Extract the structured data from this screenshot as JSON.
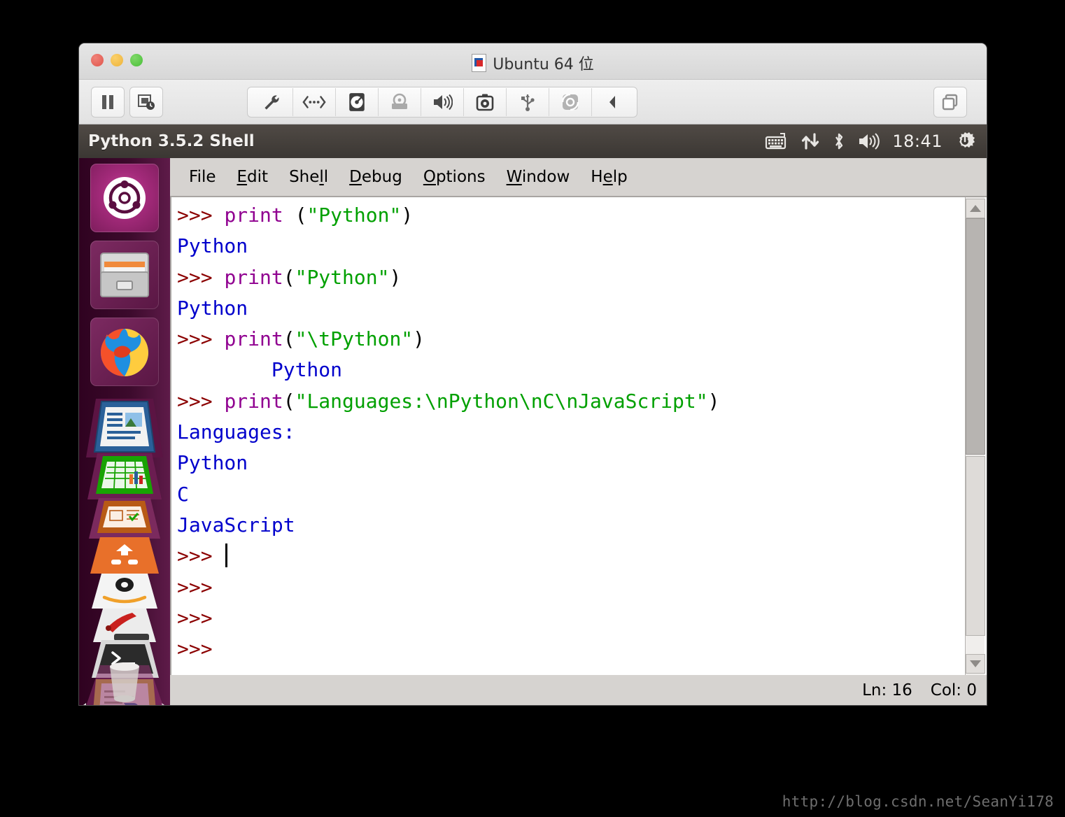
{
  "vm": {
    "title": "Ubuntu 64 位",
    "title_icon": "vm-document-icon",
    "traffic_lights": [
      {
        "name": "close-button",
        "color": "#e0564c"
      },
      {
        "name": "minimize-button",
        "color": "#edb33b"
      },
      {
        "name": "maximize-button",
        "color": "#49bf38"
      }
    ],
    "toolbar": {
      "pause_label": "Pause",
      "snapshot_label": "Snapshot",
      "unity_label": "Unity View",
      "devices": [
        {
          "name": "settings-wrench-icon",
          "label": "Settings",
          "enabled": true
        },
        {
          "name": "network-icon",
          "label": "Network Adapter",
          "enabled": true
        },
        {
          "name": "hard-disk-icon",
          "label": "Hard Disk",
          "enabled": true
        },
        {
          "name": "cd-dvd-icon",
          "label": "CD/DVD",
          "enabled": false
        },
        {
          "name": "sound-icon",
          "label": "Sound Card",
          "enabled": true
        },
        {
          "name": "camera-icon",
          "label": "Camera",
          "enabled": true
        },
        {
          "name": "usb-icon",
          "label": "USB Controller",
          "enabled": true
        },
        {
          "name": "shared-folders-icon",
          "label": "Shared Folders",
          "enabled": false
        },
        {
          "name": "collapse-arrow-icon",
          "label": "Collapse",
          "enabled": true
        }
      ]
    }
  },
  "ubuntu": {
    "panel": {
      "window_title": "Python 3.5.2 Shell",
      "clock": "18:41",
      "indicators": [
        {
          "name": "keyboard-indicator-icon",
          "label": "Keyboard layout"
        },
        {
          "name": "network-transfer-icon",
          "label": "Network"
        },
        {
          "name": "bluetooth-icon",
          "label": "Bluetooth"
        },
        {
          "name": "volume-icon",
          "label": "Sound"
        },
        {
          "name": "session-gear-icon",
          "label": "System menu"
        }
      ]
    },
    "launcher": {
      "items": [
        {
          "name": "launcher-item-dash",
          "label": "Ubuntu Dash"
        },
        {
          "name": "launcher-item-files",
          "label": "Files"
        },
        {
          "name": "launcher-item-firefox",
          "label": "Firefox Web Browser"
        },
        {
          "name": "launcher-item-writer",
          "label": "LibreOffice Writer"
        },
        {
          "name": "launcher-item-calc",
          "label": "LibreOffice Calc"
        },
        {
          "name": "launcher-item-impress",
          "label": "LibreOffice Impress"
        },
        {
          "name": "launcher-item-software",
          "label": "Ubuntu Software"
        },
        {
          "name": "launcher-item-amazon",
          "label": "Amazon"
        },
        {
          "name": "launcher-item-settings",
          "label": "System Settings"
        },
        {
          "name": "launcher-item-terminal",
          "label": "Terminal"
        },
        {
          "name": "launcher-item-idle",
          "label": "IDLE (Python 3.5)"
        },
        {
          "name": "launcher-item-trash",
          "label": "Trash"
        }
      ]
    }
  },
  "idle": {
    "menus": [
      {
        "label": "File",
        "pre": "F",
        "mnemonic": "",
        "post": "ile"
      },
      {
        "label": "Edit",
        "pre": "",
        "mnemonic": "E",
        "post": "dit"
      },
      {
        "label": "Shell",
        "pre": "She",
        "mnemonic": "l",
        "post": "l"
      },
      {
        "label": "Debug",
        "pre": "",
        "mnemonic": "D",
        "post": "ebug"
      },
      {
        "label": "Options",
        "pre": "",
        "mnemonic": "O",
        "post": "ptions"
      },
      {
        "label": "Window",
        "pre": "",
        "mnemonic": "W",
        "post": "indow"
      },
      {
        "label": "Help",
        "pre": "H",
        "mnemonic": "e",
        "post": "lp"
      }
    ],
    "status": {
      "line": "Ln: 16",
      "column": "Col: 0"
    },
    "scrollbar": {
      "up_arrow": "scroll-up-arrow",
      "down_arrow": "scroll-down-arrow"
    },
    "shell_lines": [
      [
        {
          "t": "prompt",
          "s": ">>> "
        },
        {
          "t": "kw",
          "s": "print"
        },
        {
          "t": "plain",
          "s": " ("
        },
        {
          "t": "str",
          "s": "\"Python\""
        },
        {
          "t": "plain",
          "s": ")"
        }
      ],
      [
        {
          "t": "out",
          "s": "Python"
        }
      ],
      [
        {
          "t": "prompt",
          "s": ">>> "
        },
        {
          "t": "kw",
          "s": "print"
        },
        {
          "t": "plain",
          "s": "("
        },
        {
          "t": "str",
          "s": "\"Python\""
        },
        {
          "t": "plain",
          "s": ")"
        }
      ],
      [
        {
          "t": "out",
          "s": "Python"
        }
      ],
      [
        {
          "t": "prompt",
          "s": ">>> "
        },
        {
          "t": "kw",
          "s": "print"
        },
        {
          "t": "plain",
          "s": "("
        },
        {
          "t": "str",
          "s": "\"\\tPython\""
        },
        {
          "t": "plain",
          "s": ")"
        }
      ],
      [
        {
          "t": "out",
          "s": "        Python"
        }
      ],
      [
        {
          "t": "prompt",
          "s": ">>> "
        },
        {
          "t": "kw",
          "s": "print"
        },
        {
          "t": "plain",
          "s": "("
        },
        {
          "t": "str",
          "s": "\"Languages:\\nPython\\nC\\nJavaScript\""
        },
        {
          "t": "plain",
          "s": ")"
        }
      ],
      [
        {
          "t": "out",
          "s": "Languages:"
        }
      ],
      [
        {
          "t": "out",
          "s": "Python"
        }
      ],
      [
        {
          "t": "out",
          "s": "C"
        }
      ],
      [
        {
          "t": "out",
          "s": "JavaScript"
        }
      ],
      [
        {
          "t": "prompt",
          "s": ">>> "
        },
        {
          "t": "caret",
          "s": ""
        }
      ],
      [
        {
          "t": "prompt",
          "s": ">>>"
        }
      ],
      [
        {
          "t": "prompt",
          "s": ">>>"
        }
      ],
      [
        {
          "t": "prompt",
          "s": ">>>"
        }
      ]
    ]
  },
  "watermark": {
    "text": "http://blog.csdn.net/SeanYi178"
  }
}
